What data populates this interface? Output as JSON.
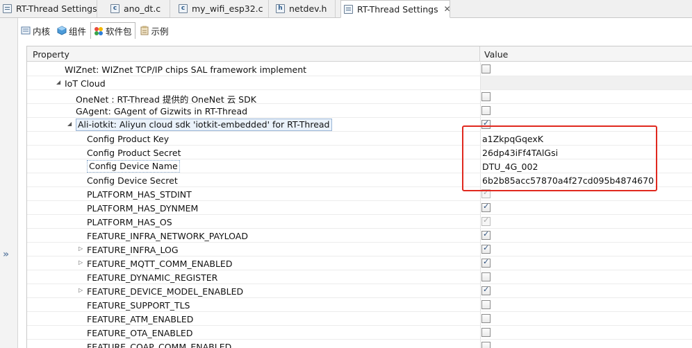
{
  "editor_tabs": [
    {
      "label": "RT-Thread Settings",
      "icon": "settings-icon"
    },
    {
      "label": "ano_dt.c",
      "icon": "c-file-icon"
    },
    {
      "label": "my_wifi_esp32.c",
      "icon": "c-file-icon"
    },
    {
      "label": "netdev.h",
      "icon": "h-file-icon"
    },
    {
      "label": "RT-Thread Settings",
      "icon": "settings-icon",
      "close": "✕"
    }
  ],
  "sub_tabs": [
    {
      "label": "内核",
      "icon": "kernel-icon"
    },
    {
      "label": "组件",
      "icon": "component-icon"
    },
    {
      "label": "软件包",
      "icon": "package-icon"
    },
    {
      "label": "示例",
      "icon": "example-icon"
    }
  ],
  "table": {
    "header_property": "Property",
    "header_value": "Value",
    "rows": [
      {
        "label": "WIZnet: WIZnet TCP/IP chips SAL framework implement",
        "value_type": "checkbox",
        "checked": false
      },
      {
        "label": "IoT Cloud",
        "value_type": "grey",
        "expanded": true
      },
      {
        "label": "OneNet : RT-Thread 提供的 OneNet 云 SDK",
        "value_type": "checkbox",
        "checked": false
      },
      {
        "label": "GAgent: GAgent of Gizwits in RT-Thread",
        "value_type": "checkbox",
        "checked": false
      },
      {
        "label": "Ali-iotkit: Aliyun cloud sdk 'iotkit-embedded' for RT-Thread",
        "value_type": "checkbox",
        "checked": true,
        "expanded": true,
        "selected": true
      },
      {
        "label": "Config Product Key",
        "value_type": "text",
        "value": "a1ZkpqGqexK"
      },
      {
        "label": "Config Product Secret",
        "value_type": "text",
        "value": "26dp43iFf4TAlGsi"
      },
      {
        "label": "Config Device Name",
        "value_type": "text",
        "value": "DTU_4G_002",
        "focused": true
      },
      {
        "label": "Config Device Secret",
        "value_type": "text",
        "value": "6b2b85acc57870a4f27cd095b4874670"
      },
      {
        "label": "PLATFORM_HAS_STDINT",
        "value_type": "checkbox",
        "checked": true,
        "disabled": true
      },
      {
        "label": "PLATFORM_HAS_DYNMEM",
        "value_type": "checkbox",
        "checked": true
      },
      {
        "label": "PLATFORM_HAS_OS",
        "value_type": "checkbox",
        "checked": true,
        "disabled": true
      },
      {
        "label": "FEATURE_INFRA_NETWORK_PAYLOAD",
        "value_type": "checkbox",
        "checked": true
      },
      {
        "label": "FEATURE_INFRA_LOG",
        "value_type": "checkbox",
        "checked": true,
        "collapsed": true
      },
      {
        "label": "FEATURE_MQTT_COMM_ENABLED",
        "value_type": "checkbox",
        "checked": true,
        "collapsed": true
      },
      {
        "label": "FEATURE_DYNAMIC_REGISTER",
        "value_type": "checkbox",
        "checked": false
      },
      {
        "label": "FEATURE_DEVICE_MODEL_ENABLED",
        "value_type": "checkbox",
        "checked": true,
        "collapsed": true
      },
      {
        "label": "FEATURE_SUPPORT_TLS",
        "value_type": "checkbox",
        "checked": false
      },
      {
        "label": "FEATURE_ATM_ENABLED",
        "value_type": "checkbox",
        "checked": false
      },
      {
        "label": "FEATURE_OTA_ENABLED",
        "value_type": "checkbox",
        "checked": false
      },
      {
        "label": "FEATURE_COAP_COMM_ENABLED",
        "value_type": "checkbox",
        "checked": false
      }
    ]
  },
  "colors": {
    "highlight_box": "#e0281e",
    "accent": "#2a4d7a"
  },
  "glyphs": {
    "collapse_arrow": "»",
    "check": "✓",
    "expanded": "◢",
    "collapsed": "▷"
  }
}
